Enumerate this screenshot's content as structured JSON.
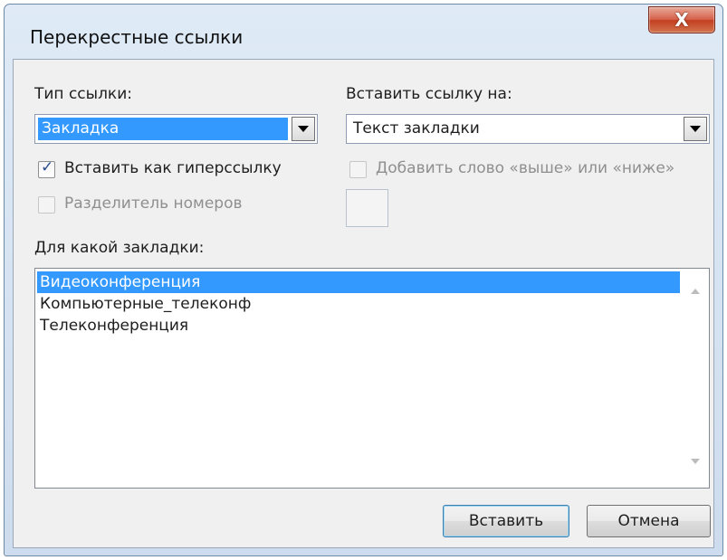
{
  "window": {
    "title": "Перекрестные ссылки",
    "close_glyph": "X"
  },
  "ref_type": {
    "label": "Тип ссылки:",
    "value": "Закладка"
  },
  "insert_ref": {
    "label": "Вставить ссылку на:",
    "value": "Текст закладки"
  },
  "hyperlink_checkbox": {
    "label": "Вставить как гиперссылку",
    "checked": true
  },
  "above_below_checkbox": {
    "label": "Добавить слово «выше» или «ниже»",
    "checked": false,
    "enabled": false
  },
  "separator_checkbox": {
    "label": "Разделитель номеров",
    "checked": false,
    "enabled": false
  },
  "for_which": {
    "label": "Для какой закладки:",
    "items": [
      "Видеоконференция",
      "Компьютерные_телеконф",
      "Телеконференция"
    ],
    "selected_index": 0
  },
  "buttons": {
    "insert": "Вставить",
    "cancel": "Отмена"
  },
  "colors": {
    "selection": "#3399ff",
    "check": "#2b4c8c",
    "close": "#c23f21"
  }
}
